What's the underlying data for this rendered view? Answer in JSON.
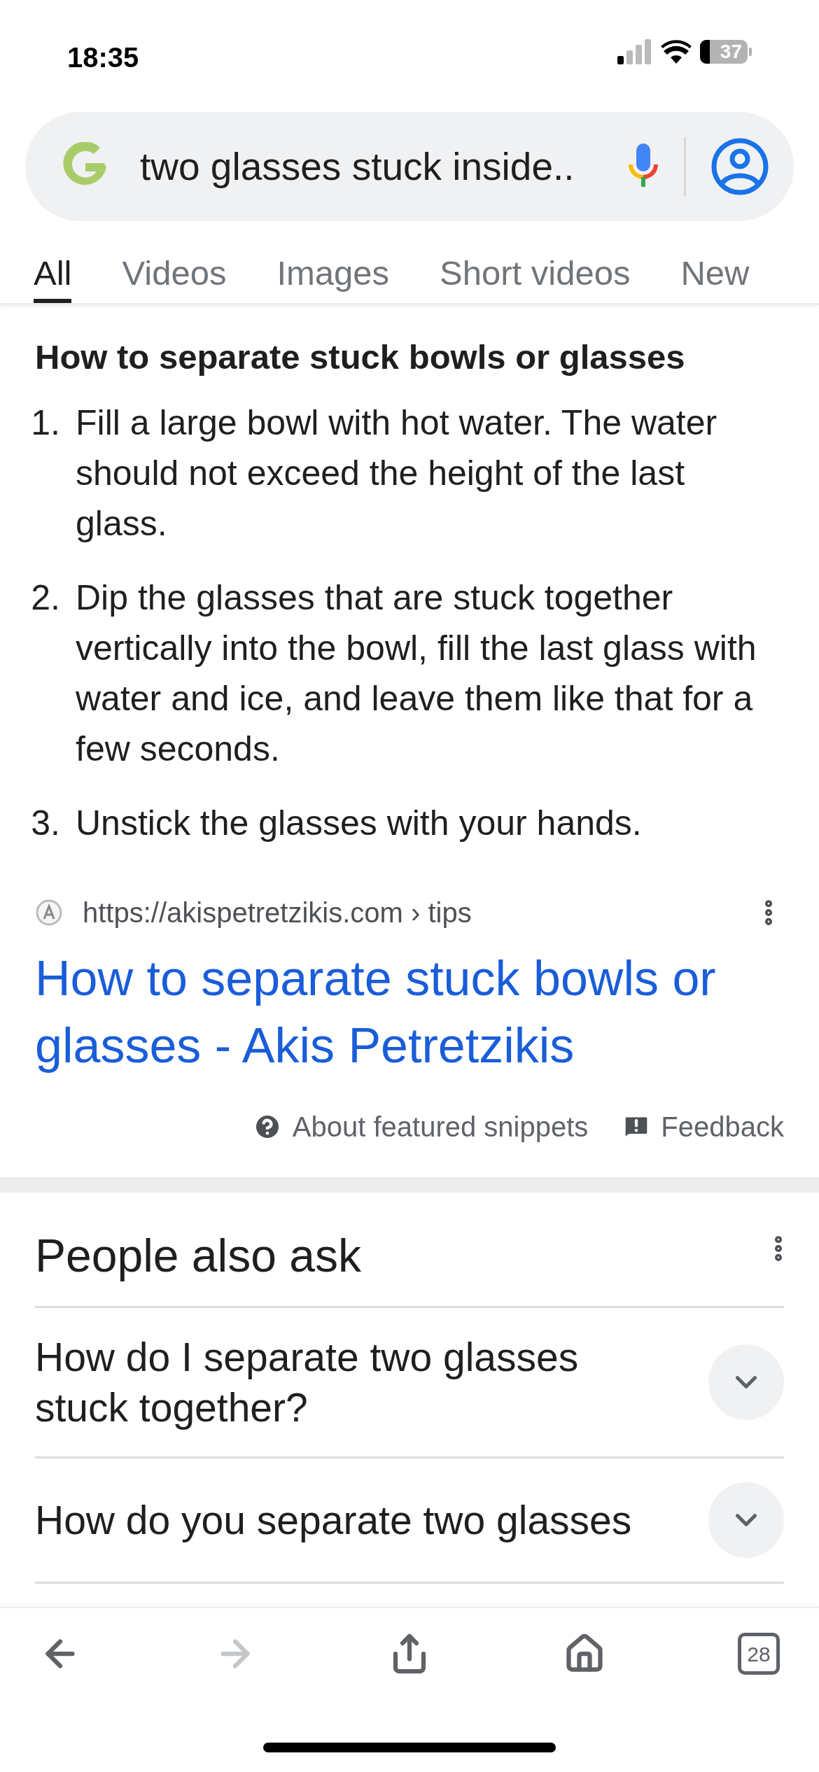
{
  "status_bar": {
    "time": "18:35",
    "battery": "37"
  },
  "search": {
    "query": "two glasses stuck inside.."
  },
  "tabs": [
    {
      "label": "All",
      "selected": true
    },
    {
      "label": "Videos",
      "selected": false
    },
    {
      "label": "Images",
      "selected": false
    },
    {
      "label": "Short videos",
      "selected": false
    },
    {
      "label": "New",
      "selected": false
    }
  ],
  "snippet": {
    "heading": "How to separate stuck bowls or glasses",
    "steps": [
      {
        "number": "1.",
        "text": "Fill a large bowl with hot water. The water should not exceed the height of the last glass."
      },
      {
        "number": "2.",
        "text": "Dip the glasses that are stuck together vertically into the bowl, fill the last glass with water and ice, and leave them like that for a few seconds."
      },
      {
        "number": "3.",
        "text": "Unstick the glasses with your hands."
      }
    ],
    "source_url": "https://akispetretzikis.com › tips",
    "title": "How to separate stuck bowls or glasses - Akis Petretzikis",
    "about": "About featured snippets",
    "feedback": "Feedback"
  },
  "people_also_ask": {
    "title": "People also ask",
    "questions": [
      {
        "text": "How do I separate two glasses stuck together?",
        "expanded": false
      },
      {
        "text": "How do you separate two glasses",
        "expanded": false
      }
    ]
  },
  "toolbar": {
    "tab_count": "28"
  }
}
